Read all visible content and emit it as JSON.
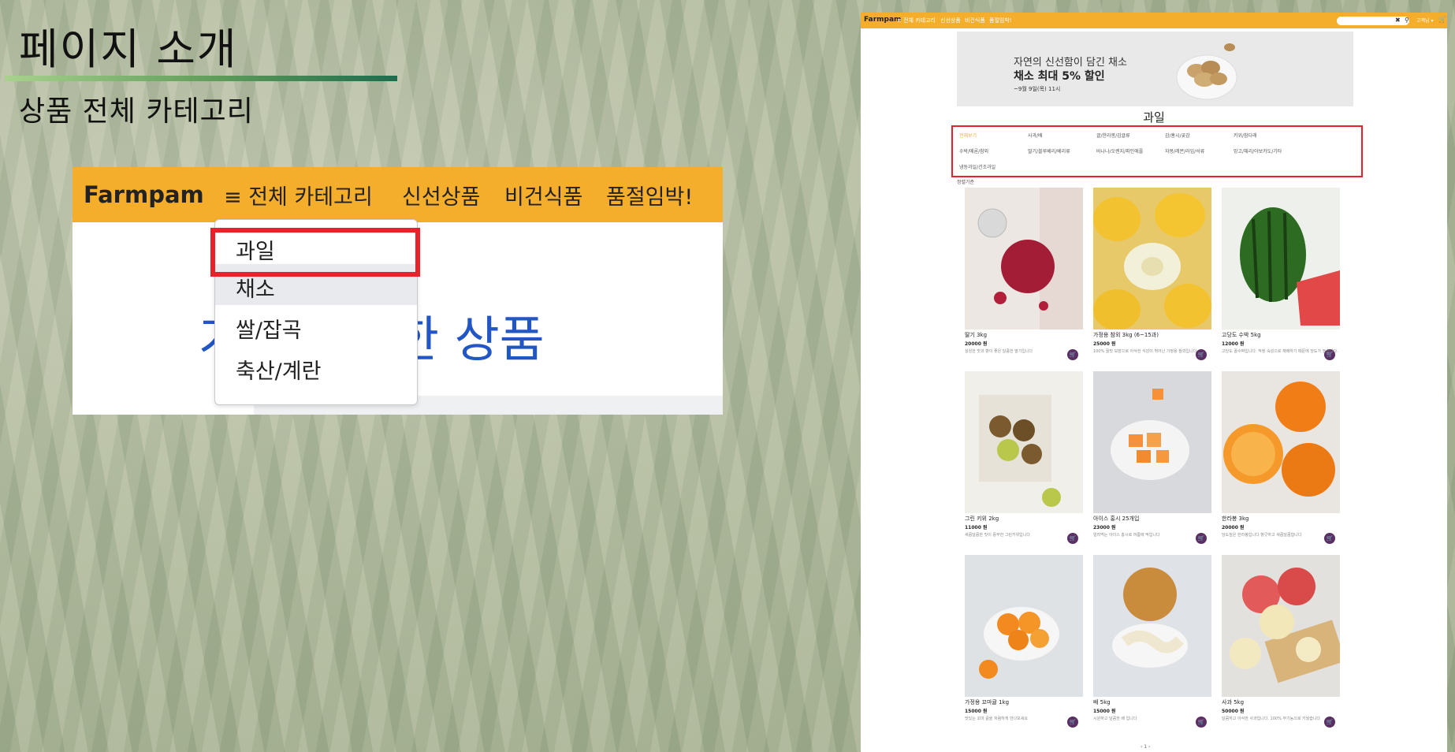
{
  "slide": {
    "title": "페이지 소개",
    "subtitle": "상품 전체 카테고리"
  },
  "zoom": {
    "brand": "Farmpam",
    "nav": [
      "≡ 전체 카테고리",
      "신선상품",
      "비건식품",
      "품절임박!"
    ],
    "dropdown": [
      "과일",
      "채소",
      "쌀/잡곡",
      "축산/계란"
    ],
    "hero_text": "가장 신선한 상품"
  },
  "shot": {
    "brand": "Farmpam",
    "nav": [
      "≡ 전체 카테고리",
      "신선상품",
      "비건식품",
      "품절임박!"
    ],
    "user_menu": "고객님 ▾",
    "banner": {
      "line1": "자연의 신선함이 담긴 채소",
      "line2": "채소 최대 5% 할인",
      "line3": "~9월 9일(목) 11시"
    },
    "category_title": "과일",
    "subcategories": [
      "전체보기",
      "사과/배",
      "귤/한라봉/감귤류",
      "감/홍시/곶감",
      "키위/참다래",
      "수박/메론/참외",
      "딸기/블루베리/베리류",
      "바나나/오렌지/파인애플",
      "자몽/레몬/라임/석류",
      "망고/체리/아보카도/기타",
      "냉동과일/건조과일"
    ],
    "sort_label": "정렬기준",
    "products": [
      {
        "name": "딸기 3kg",
        "price": "20000 원",
        "desc": "싱싱한 맛과 향이 좋은 달콤한 딸기입니다"
      },
      {
        "name": "가정용 참외 3kg (6~15과)",
        "price": "25000 원",
        "desc": "100% 꿀맛 보장으로 아삭한 식감이 뛰어난 가정용 참외입니다"
      },
      {
        "name": "고당도 수박 5kg",
        "price": "12000 원",
        "desc": "고당도 꿀수박입니다. 적정 숙성으로 재배하기 때문에 당도가 높습니다."
      },
      {
        "name": "그린 키위 2kg",
        "price": "11000 원",
        "desc": "새콤달콤한 맛이 풍부한 그린키위입니다"
      },
      {
        "name": "아이스 홍시 25개입",
        "price": "23000 원",
        "desc": "얼려먹는 아이스 홍시로 여름에 딱입니다"
      },
      {
        "name": "한라봉 3kg",
        "price": "20000 원",
        "desc": "당도높은 한라봉입니다 향긋하고 새콤달콤합니다"
      },
      {
        "name": "가정용 꼬마귤 1kg",
        "price": "15000 원",
        "desc": "맛있는 꼬마 귤을 저렴하게 만나보세요"
      },
      {
        "name": "배 5kg",
        "price": "15000 원",
        "desc": "시원하고 달콤한 배 입니다"
      },
      {
        "name": "사과 5kg",
        "price": "50000 원",
        "desc": "달콤하고 아삭한 사과입니다. 100% 무기농으로 키웠습니다"
      }
    ],
    "pagination": "‹  1  ›"
  },
  "colors": {
    "nav_orange": "#f5ae2c",
    "highlight_red": "#e8212b",
    "hero_blue": "#2256c4",
    "cart_purple": "#5a2f63"
  },
  "icons": [
    "menu-icon",
    "search-icon",
    "clear-icon",
    "cart-icon",
    "cart-button-icon"
  ]
}
